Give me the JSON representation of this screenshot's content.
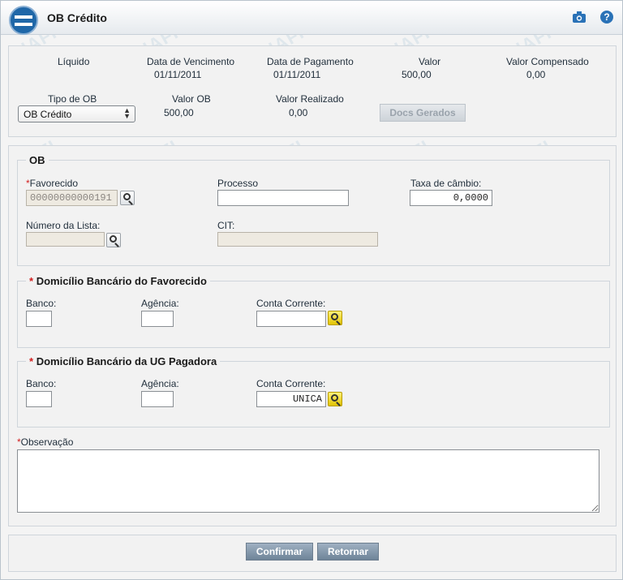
{
  "window": {
    "title": "OB Crédito",
    "watermark": "SIAFI"
  },
  "header_icons": {
    "camera": "camera-icon",
    "help": "help-icon",
    "help_glyph": "?"
  },
  "summary": {
    "liquido_label": "Líquido",
    "data_vencimento_label": "Data de Vencimento",
    "data_vencimento": "01/11/2011",
    "data_pagamento_label": "Data de Pagamento",
    "data_pagamento": "01/11/2011",
    "valor_label": "Valor",
    "valor": "500,00",
    "valor_compensado_label": "Valor Compensado",
    "valor_compensado": "0,00",
    "tipo_ob_label": "Tipo de OB",
    "tipo_ob_selected": "OB Crédito",
    "valor_ob_label": "Valor OB",
    "valor_ob": "500,00",
    "valor_realizado_label": "Valor Realizado",
    "valor_realizado": "0,00",
    "docs_gerados_button": "Docs Gerados"
  },
  "ob": {
    "legend": "OB",
    "favorecido_label": "Favorecido",
    "favorecido_value": "00000000000191",
    "processo_label": "Processo",
    "processo_value": "",
    "taxa_cambio_label": "Taxa de câmbio:",
    "taxa_cambio_value": "0,0000",
    "numero_lista_label": "Número da Lista:",
    "numero_lista_value": "",
    "cit_label": "CIT:",
    "cit_value": ""
  },
  "domicilio_favorecido": {
    "legend": "Domicílio Bancário do Favorecido",
    "banco_label": "Banco:",
    "banco_value": "",
    "agencia_label": "Agência:",
    "agencia_value": "",
    "conta_label": "Conta Corrente:",
    "conta_value": ""
  },
  "domicilio_ug": {
    "legend": "Domicílio Bancário da UG Pagadora",
    "banco_label": "Banco:",
    "banco_value": "",
    "agencia_label": "Agência:",
    "agencia_value": "",
    "conta_label": "Conta Corrente:",
    "conta_value": "UNICA"
  },
  "observacao": {
    "label": "Observação",
    "value": ""
  },
  "actions": {
    "confirmar": "Confirmar",
    "retornar": "Retornar"
  },
  "required_marker": "*",
  "colors": {
    "accent": "#1f67a8",
    "required": "#d21f1f",
    "button": "#7b90a5",
    "lookup_yellow": "#f2d400"
  }
}
